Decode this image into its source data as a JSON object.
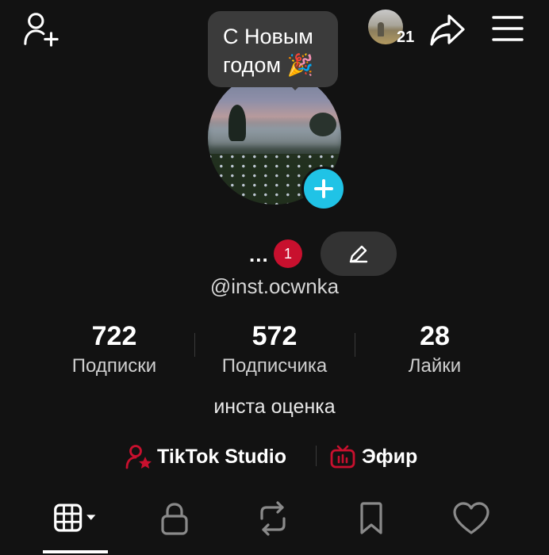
{
  "header": {
    "add_friend_icon": "person-plus-icon",
    "visitors_count": "21",
    "share_icon": "share-arrow-icon",
    "menu_icon": "hamburger-menu-icon"
  },
  "tooltip": {
    "line1": "С Новым",
    "line2": "годом 🎉"
  },
  "profile": {
    "name": "...",
    "notification_count": "1",
    "handle": "@inst.ocwnka",
    "bio": "инста оценка"
  },
  "stats": [
    {
      "value": "722",
      "label": "Подписки"
    },
    {
      "value": "572",
      "label": "Подписчика"
    },
    {
      "value": "28",
      "label": "Лайки"
    }
  ],
  "links": {
    "studio_label": "TikTok Studio",
    "live_label": "Эфир"
  },
  "colors": {
    "background": "#121212",
    "accent_red": "#c8102e",
    "accent_cyan": "#20c3e6"
  }
}
